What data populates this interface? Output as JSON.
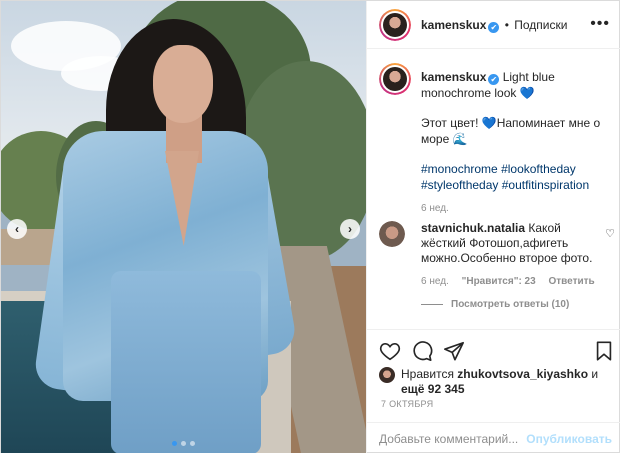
{
  "post": {
    "author": {
      "username": "kamenskux",
      "verified_mark": "✔",
      "separator": "•",
      "follow_label": "Подписки"
    },
    "more_icon": "more-horizontal-icon",
    "carousel": {
      "prev_glyph": "‹",
      "next_glyph": "›",
      "current_slide": 1,
      "slide_count": 3
    },
    "caption": {
      "username": "kamenskux",
      "line1": "Light blue monochrome look 💙",
      "line2": "Этот цвет! 💙Напоминает мне о море 🌊",
      "hashtags": [
        "#monochrome",
        "#lookoftheday",
        "#styleoftheday",
        "#outfitinspiration"
      ],
      "time": "6 нед."
    },
    "comment": {
      "username": "stavnichuk.natalia",
      "text": "Какой жёсткий Фотошоп,афигеть можно.Особенно второе фото.",
      "time": "6 нед.",
      "likes": "\"Нравится\": 23",
      "reply_label": "Ответить",
      "view_replies": "Посмотреть ответы (10)"
    },
    "actions": {
      "like_icon": "heart-icon",
      "comment_icon": "comment-icon",
      "share_icon": "share-icon",
      "save_icon": "bookmark-icon"
    },
    "likes": {
      "prefix": "Нравится",
      "user": "zhukovtsova_kiyashko",
      "conj": "и",
      "rest": "ещё 92 345"
    },
    "date": "7 ОКТЯБРЯ",
    "add_comment": {
      "placeholder": "Добавьте комментарий...",
      "publish_label": "Опубликовать"
    },
    "colors": {
      "accent": "#3897f0",
      "publish_disabled": "#b2dffc",
      "hashtag": "#00376b",
      "muted": "#8e8e8e"
    }
  }
}
